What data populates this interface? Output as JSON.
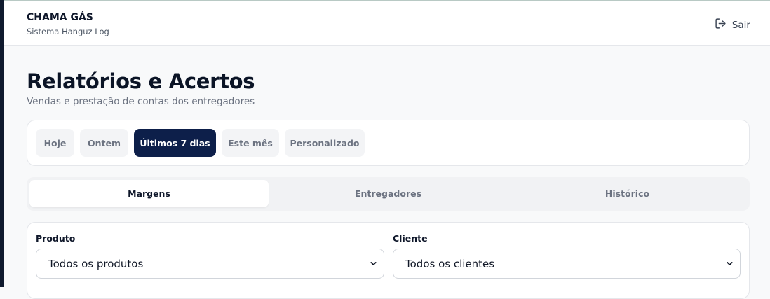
{
  "header": {
    "app_name": "CHAMA GÁS",
    "app_subtitle": "Sistema Hanguz Log",
    "logout_label": "Sair"
  },
  "page": {
    "title": "Relatórios e Acertos",
    "subtitle": "Vendas e prestação de contas dos entregadores"
  },
  "period_filters": [
    {
      "label": "Hoje",
      "active": false
    },
    {
      "label": "Ontem",
      "active": false
    },
    {
      "label": "Últimos 7 dias",
      "active": true
    },
    {
      "label": "Este mês",
      "active": false
    },
    {
      "label": "Personalizado",
      "active": false
    }
  ],
  "tabs": [
    {
      "label": "Margens",
      "active": true
    },
    {
      "label": "Entregadores",
      "active": false
    },
    {
      "label": "Histórico",
      "active": false
    }
  ],
  "filters": {
    "product": {
      "label": "Produto",
      "value": "Todos os produtos"
    },
    "client": {
      "label": "Cliente",
      "value": "Todos os clientes"
    }
  },
  "colors": {
    "accent": "#0d1f4a",
    "sidebar_edge": "#0f1a2e"
  }
}
